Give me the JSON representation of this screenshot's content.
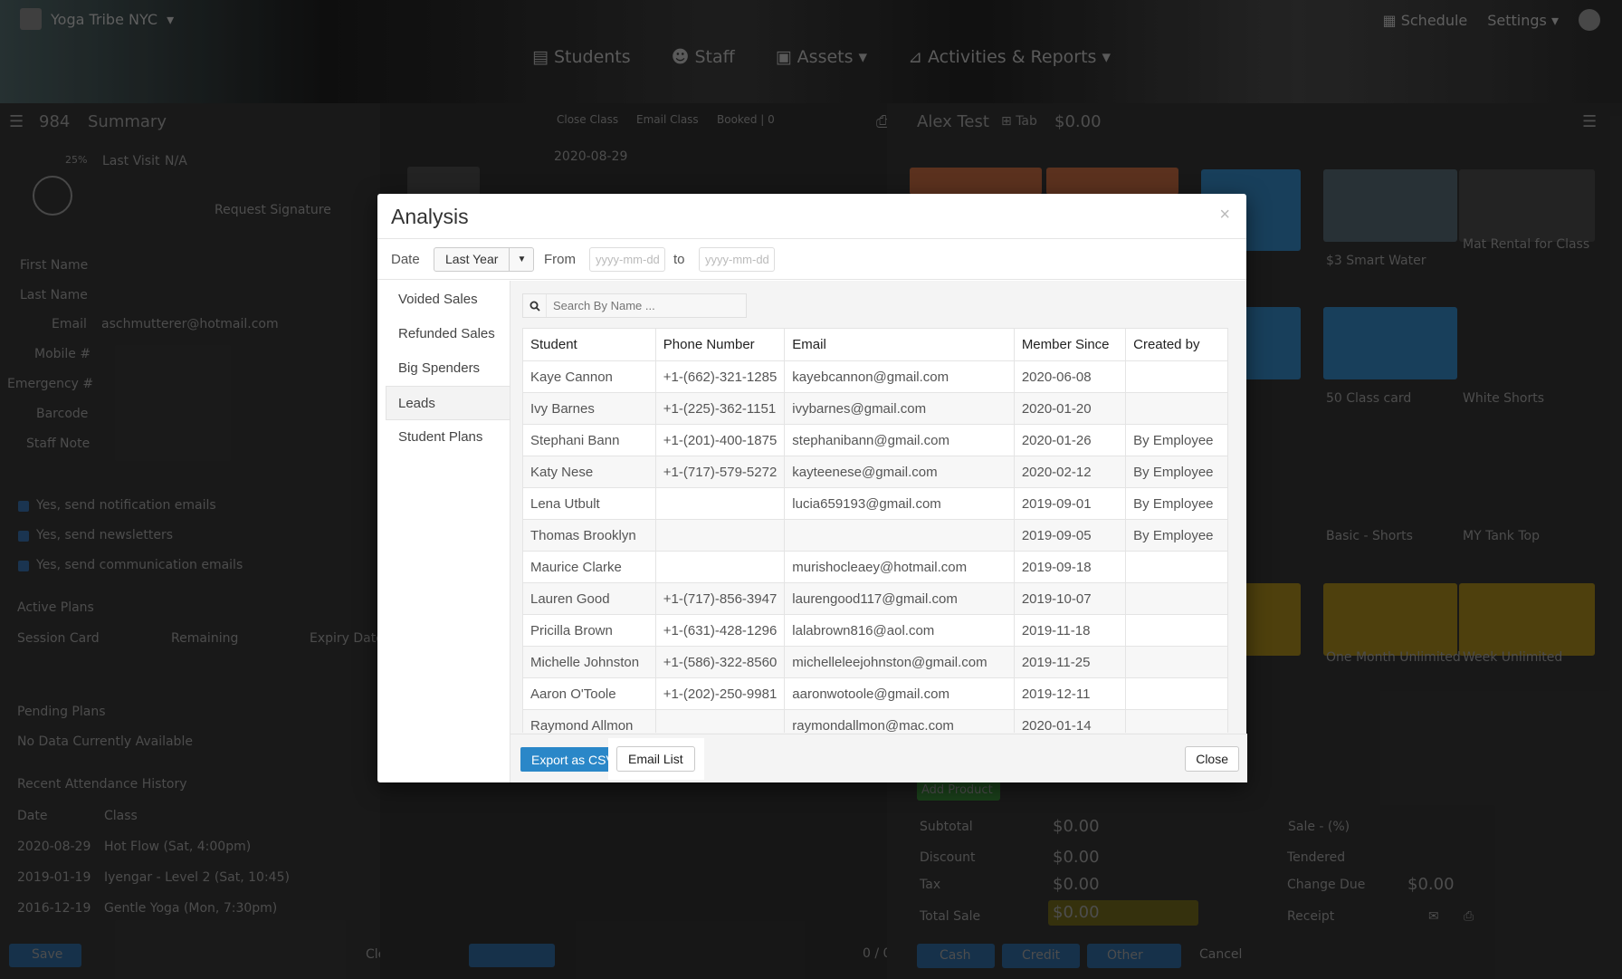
{
  "app": {
    "brand": "Yoga Tribe NYC",
    "nav": [
      "Students",
      "Staff",
      "Assets",
      "Activities & Reports"
    ],
    "top_right": [
      "Schedule",
      "Settings"
    ]
  },
  "background": {
    "left": {
      "count": "984",
      "title": "Summary",
      "last_visit_label": "Last Visit",
      "last_visit_value": "N/A",
      "request_signature": "Request Signature",
      "fields": [
        "First Name",
        "Last Name",
        "Email",
        "Mobile #",
        "Emergency #",
        "Barcode",
        "Staff Note"
      ],
      "email_value": "aschmutterer@hotmail.com",
      "checkboxes": [
        "Yes, send notification emails",
        "Yes, send newsletters",
        "Yes, send communication emails"
      ],
      "active_plans": "Active Plans",
      "plan_headers": [
        "Session Card",
        "Remaining",
        "Expiry Date"
      ],
      "pending_plans": "Pending Plans",
      "no_data": "No Data Currently Available",
      "attendance": "Recent Attendance History",
      "attendance_headers": [
        "Date",
        "Class"
      ],
      "attendance_rows": [
        [
          "2020-08-29",
          "Hot Flow (Sat, 4:00pm)"
        ],
        [
          "2019-01-19",
          "Iyengar - Level 2 (Sat, 10:45)"
        ],
        [
          "2016-12-19",
          "Gentle Yoga (Mon, 7:30pm)"
        ]
      ],
      "save": "Save",
      "clear": "Clear / New"
    },
    "center": {
      "tabs": [
        "Close Class",
        "Email Class",
        "Booked | 0"
      ],
      "date": "2020-08-29"
    },
    "right": {
      "name": "Alex Test",
      "tab": "Tab",
      "balance": "$0.00",
      "products": [
        "$3 Smart Water",
        "Mat Rental for Class",
        "50 Class card",
        "White Shorts",
        "Basic - Shorts",
        "MY Tank Top",
        "One Month Unlimited",
        "Week Unlimited"
      ],
      "add_product": "Add Product",
      "subtotal_label": "Subtotal",
      "discount_label": "Discount",
      "tax_label": "Tax",
      "total_label": "Total Sale",
      "tendered": "Tendered",
      "change_due": "Change Due",
      "receipt": "Receipt",
      "sale_btn": "Sale - (%)",
      "amount": "$0.00",
      "buttons": [
        "Cash",
        "Credit",
        "Other",
        "Cancel"
      ]
    }
  },
  "modal": {
    "title": "Analysis",
    "close_x": "×",
    "date_label": "Date",
    "date_value": "Last Year",
    "from_label": "From",
    "to_label": "to",
    "date_placeholder": "yyyy-mm-dd",
    "side_items": [
      "Voided Sales",
      "Refunded Sales",
      "Big Spenders",
      "Leads",
      "Student Plans"
    ],
    "active_side": "Leads",
    "search_placeholder": "Search By Name ...",
    "columns": [
      "Student",
      "Phone Number",
      "Email",
      "Member Since",
      "Created by"
    ],
    "rows": [
      [
        "Kaye Cannon",
        "+1-(662)-321-1285",
        "kayebcannon@gmail.com",
        "2020-06-08",
        ""
      ],
      [
        "Ivy Barnes",
        "+1-(225)-362-1151",
        "ivybarnes@gmail.com",
        "2020-01-20",
        ""
      ],
      [
        "Stephani Bann",
        "+1-(201)-400-1875",
        "stephanibann@gmail.com",
        "2020-01-26",
        "By Employee"
      ],
      [
        "Katy Nese",
        "+1-(717)-579-5272",
        "kayteenese@gmail.com",
        "2020-02-12",
        "By Employee"
      ],
      [
        "Lena Utbult",
        "",
        "lucia659193@gmail.com",
        "2019-09-01",
        "By Employee"
      ],
      [
        "Thomas Brooklyn",
        "",
        "",
        "2019-09-05",
        "By Employee"
      ],
      [
        "Maurice Clarke",
        "",
        "murishocleaey@hotmail.com",
        "2019-09-18",
        ""
      ],
      [
        "Lauren Good",
        "+1-(717)-856-3947",
        "laurengood117@gmail.com",
        "2019-10-07",
        ""
      ],
      [
        "Pricilla Brown",
        "+1-(631)-428-1296",
        "lalabrown816@aol.com",
        "2019-11-18",
        ""
      ],
      [
        "Michelle Johnston",
        "+1-(586)-322-8560",
        "michelleleejohnston@gmail.com",
        "2019-11-25",
        ""
      ],
      [
        "Aaron O'Toole",
        "+1-(202)-250-9981",
        "aaronwotoole@gmail.com",
        "2019-12-11",
        ""
      ],
      [
        "Raymond Allmon",
        "",
        "raymondallmon@mac.com",
        "2020-01-14",
        ""
      ]
    ],
    "export_btn": "Export as CSV",
    "email_btn": "Email List",
    "close_btn": "Close"
  }
}
